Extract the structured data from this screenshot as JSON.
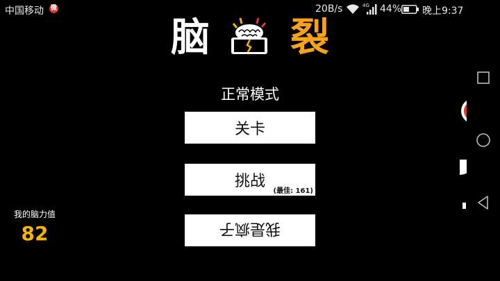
{
  "status_bar": {
    "carrier": "中国移动",
    "net_speed": "20B/s",
    "network_type": "4G",
    "battery": "44%",
    "time": "晚上9:37"
  },
  "title": {
    "left": "脑",
    "right": "裂"
  },
  "mode_label": "正常模式",
  "menu": {
    "levels": "关卡",
    "challenge": "挑战",
    "challenge_best": "(最佳: 161)",
    "crazy": "我是疯子"
  },
  "brain_power": {
    "label": "我的脑力值",
    "value": "82"
  },
  "colors": {
    "background": "#000000",
    "accent_orange": "#f7a21b",
    "score_yellow": "#f7b500",
    "button_bg": "#ffffff"
  },
  "icons": [
    "weibo-icon",
    "wifi-icon",
    "signal-icon",
    "battery-icon",
    "brain-logo",
    "recent-apps-icon",
    "home-icon",
    "back-icon"
  ]
}
